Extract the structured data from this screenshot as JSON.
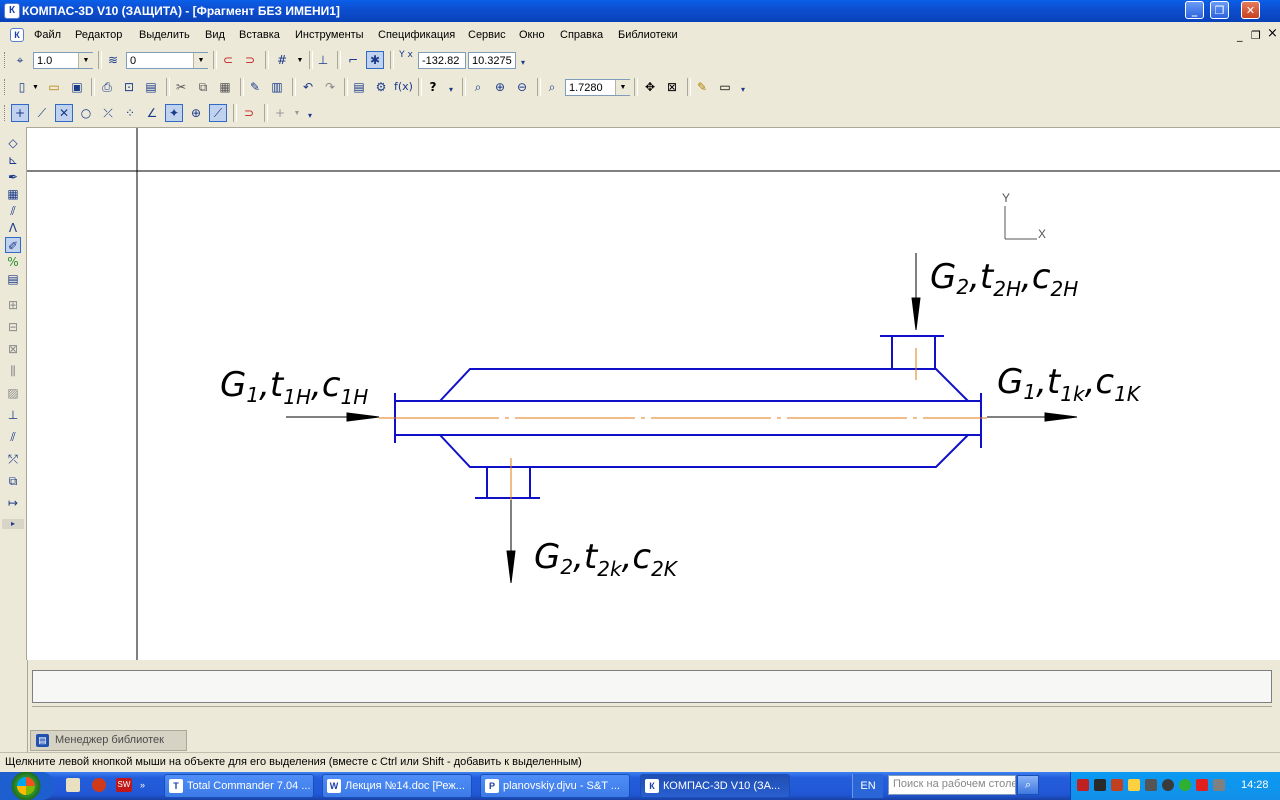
{
  "window": {
    "title": "КОМПАС-3D V10 (ЗАЩИТА) - [Фрагмент БЕЗ ИМЕНИ1]",
    "app_icon": "К",
    "minimize_glyph": "_",
    "maximize_glyph": "❐",
    "close_glyph": "✕"
  },
  "menu": {
    "items": [
      "Файл",
      "Редактор",
      "Выделить",
      "Вид",
      "Вставка",
      "Инструменты",
      "Спецификация",
      "Сервис",
      "Окно",
      "Справка",
      "Библиотеки"
    ],
    "mdi_minimize": "_",
    "mdi_restore": "❐",
    "mdi_close": "×"
  },
  "toolbar1": {
    "scale_value": "1.0",
    "layer_value": "0",
    "coord_x": "-132.82",
    "coord_y": "10.3275",
    "coord_label": "Y x"
  },
  "toolbar2": {
    "fx_label": "f(x)",
    "zoom_value": "1.7280"
  },
  "drawing": {
    "axis_y_label": "Y",
    "axis_x_label": "X",
    "labels": {
      "inlet1": {
        "G": "G",
        "G_sub": "1",
        "t": "t",
        "t_sub": "1H",
        "c": "c",
        "c_sub": "1H"
      },
      "outlet1": {
        "G": "G",
        "G_sub": "1",
        "t": "t",
        "t_sub": "1k",
        "c": "c",
        "c_sub": "1K"
      },
      "inlet2": {
        "G": "G",
        "G_sub": "2",
        "t": "t",
        "t_sub": "2H",
        "c": "c",
        "c_sub": "2H"
      },
      "outlet2": {
        "G": "G",
        "G_sub": "2",
        "t": "t",
        "t_sub": "2k",
        "c": "c",
        "c_sub": "2K"
      },
      "comma": ","
    },
    "colors": {
      "contour": "#1010c8",
      "axis": "#e07a10",
      "arrow": "#000000"
    }
  },
  "library_tab": {
    "label": "Менеджер библиотек"
  },
  "status": {
    "text": "Щелкните левой кнопкой мыши на объекте для его выделения (вместе с Ctrl или Shift - добавить к выделенным)"
  },
  "taskbar": {
    "tasks": [
      {
        "label": "Total Commander 7.04 ...",
        "icon": "T"
      },
      {
        "label": "Лекция №14.doc [Реж...",
        "icon": "W"
      },
      {
        "label": "planovskiy.djvu - S&T ...",
        "icon": "P"
      },
      {
        "label": "КОМПАС-3D V10 (ЗА...",
        "icon": "К"
      }
    ],
    "lang": "EN",
    "search_placeholder": "Поиск на рабочем столе",
    "clock": "14:28"
  }
}
